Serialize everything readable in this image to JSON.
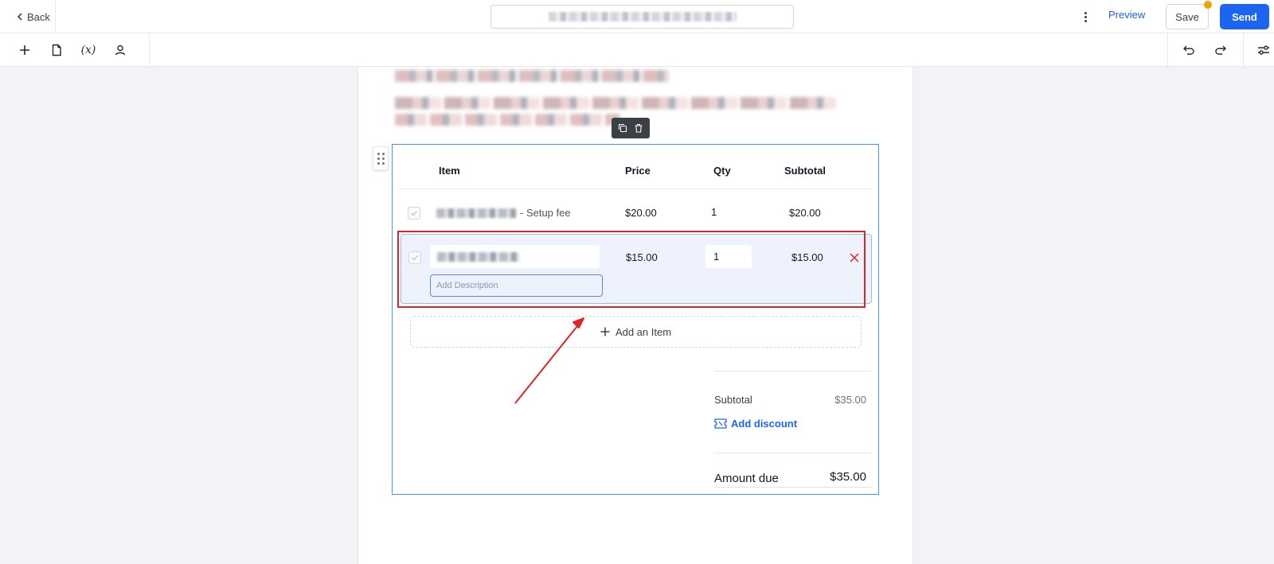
{
  "topbar": {
    "back_label": "Back",
    "preview_label": "Preview",
    "save_label": "Save",
    "send_label": "Send"
  },
  "toolbar": {
    "tools": [
      "plus-icon",
      "page-icon",
      "variable-icon",
      "user-icon"
    ],
    "variable_label": "(x)",
    "right_tools": [
      "undo-icon",
      "redo-icon",
      "settings-sliders-icon"
    ]
  },
  "table": {
    "headers": {
      "item": "Item",
      "price": "Price",
      "qty": "Qty",
      "subtotal": "Subtotal"
    },
    "rows": [
      {
        "name_suffix": "- Setup fee",
        "price": "$20.00",
        "qty": "1",
        "subtotal": "$20.00"
      },
      {
        "price": "$15.00",
        "qty": "1",
        "subtotal": "$15.00",
        "description_placeholder": "Add Description"
      }
    ],
    "add_item_label": "Add an Item"
  },
  "summary": {
    "subtotal_label": "Subtotal",
    "subtotal_value": "$35.00",
    "discount_label": "Add discount",
    "amount_due_label": "Amount due",
    "amount_due_value": "$35.00"
  },
  "colors": {
    "accent": "#1c64f2",
    "highlight": "#e02424",
    "selection_border": "#3b9bff",
    "row_fill": "#eef2fc",
    "unsaved_dot": "#f59e0b"
  }
}
